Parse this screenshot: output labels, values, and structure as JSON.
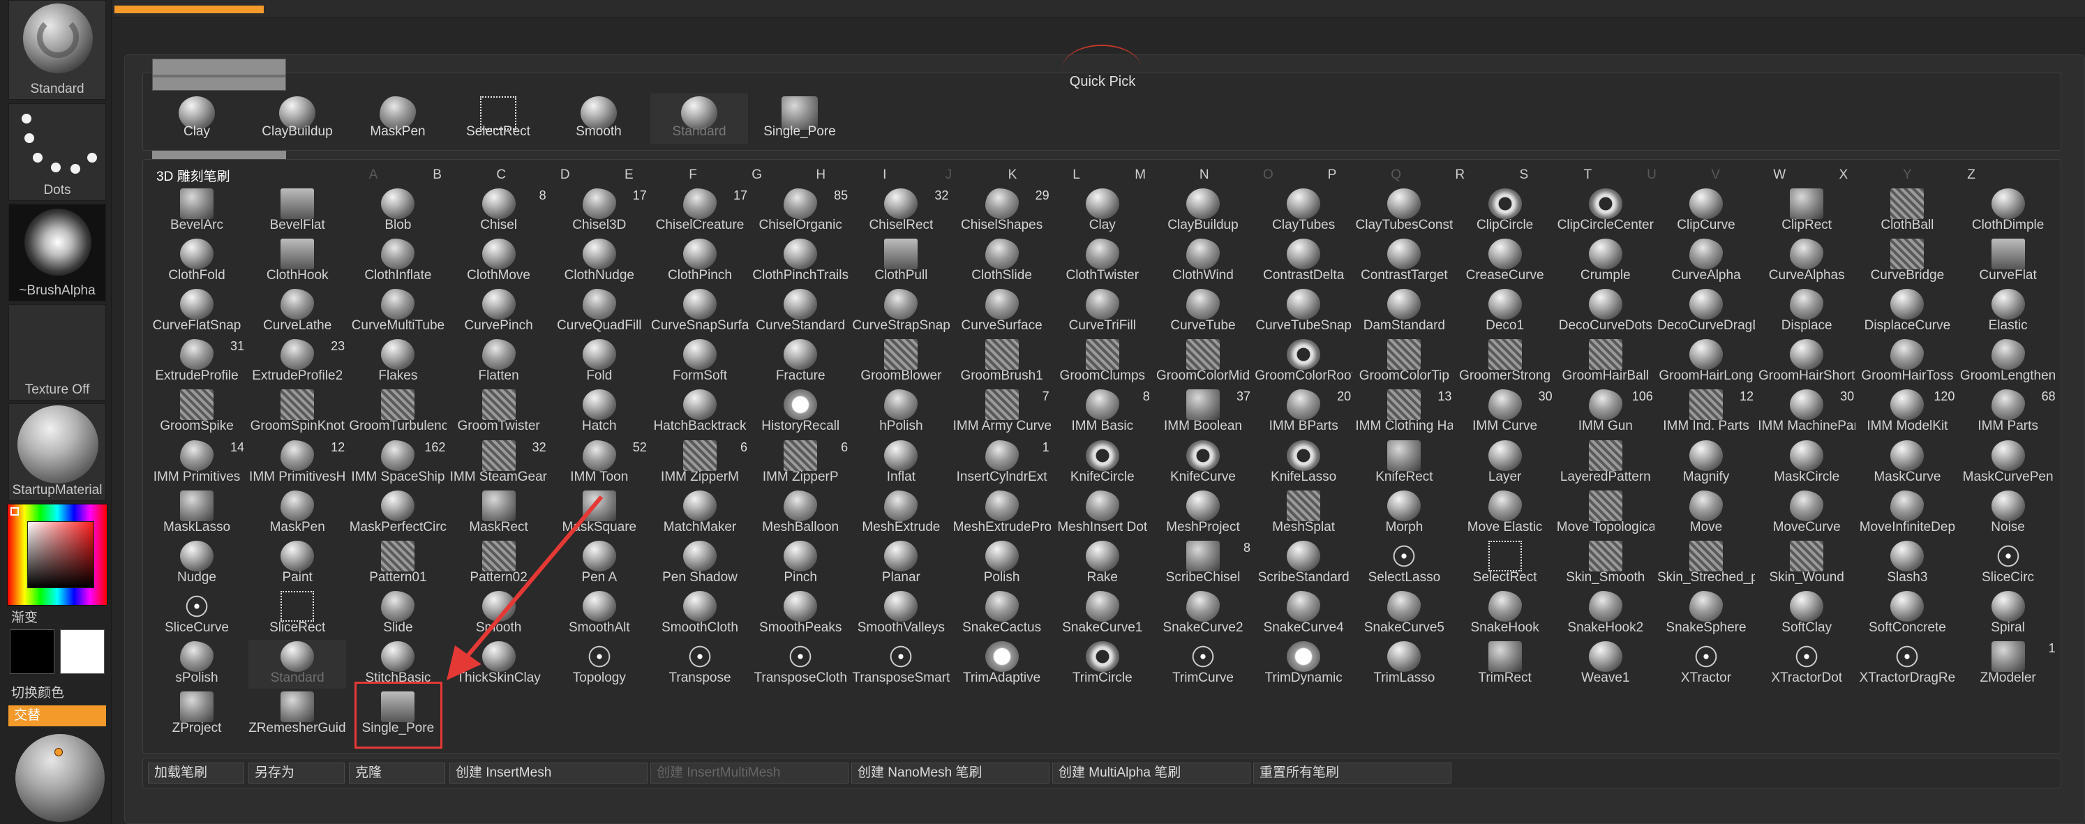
{
  "left_tray": {
    "brush_label": "Standard",
    "stroke_label": "Dots",
    "alpha_label": "~BrushAlpha",
    "texture_label": "Texture Off",
    "material_label": "StartupMaterial",
    "gradient_label": "渐变",
    "switch_color_label": "切换颜色",
    "alternate_label": "交替",
    "active_color": "#000000",
    "secondary_color": "#ffffff",
    "accent_color": "#f39a2b"
  },
  "quick_pick": {
    "title": "Quick Pick",
    "items": [
      {
        "label": "Clay",
        "icon": "sphere"
      },
      {
        "label": "ClayBuildup",
        "icon": "sphere"
      },
      {
        "label": "MaskPen",
        "icon": "mask"
      },
      {
        "label": "SelectRect",
        "icon": "select-rect"
      },
      {
        "label": "Smooth",
        "icon": "sphere"
      },
      {
        "label": "Standard",
        "icon": "sphere",
        "disabled": true
      },
      {
        "label": "Single_Pore",
        "icon": "square"
      }
    ]
  },
  "brushes": {
    "title": "3D 雕刻笔刷",
    "letters": [
      {
        "ch": "A",
        "dim": true
      },
      {
        "ch": "B"
      },
      {
        "ch": "C"
      },
      {
        "ch": "D"
      },
      {
        "ch": "E"
      },
      {
        "ch": "F"
      },
      {
        "ch": "G"
      },
      {
        "ch": "H"
      },
      {
        "ch": "I"
      },
      {
        "ch": "J",
        "dim": true
      },
      {
        "ch": "K"
      },
      {
        "ch": "L"
      },
      {
        "ch": "M"
      },
      {
        "ch": "N"
      },
      {
        "ch": "O",
        "dim": true
      },
      {
        "ch": "P"
      },
      {
        "ch": "Q",
        "dim": true
      },
      {
        "ch": "R"
      },
      {
        "ch": "S"
      },
      {
        "ch": "T"
      },
      {
        "ch": "U",
        "dim": true
      },
      {
        "ch": "V",
        "dim": true
      },
      {
        "ch": "W"
      },
      {
        "ch": "X"
      },
      {
        "ch": "Y",
        "dim": true
      },
      {
        "ch": "Z"
      }
    ],
    "rows": [
      [
        {
          "label": "BevelArc",
          "icon": "sq"
        },
        {
          "label": "BevelFlat",
          "icon": "flat"
        },
        {
          "label": "Blob",
          "icon": "sphere"
        },
        {
          "label": "Chisel",
          "icon": "sphere",
          "count": "8"
        },
        {
          "label": "Chisel3D",
          "icon": "blob",
          "count": "17"
        },
        {
          "label": "ChiselCreature",
          "icon": "blob",
          "count": "17"
        },
        {
          "label": "ChiselOrganic",
          "icon": "blob",
          "count": "85"
        },
        {
          "label": "ChiselRect",
          "icon": "sphere",
          "count": "32"
        },
        {
          "label": "ChiselShapes",
          "icon": "blob",
          "count": "29"
        },
        {
          "label": "Clay",
          "icon": "sphere"
        },
        {
          "label": "ClayBuildup",
          "icon": "sphere"
        },
        {
          "label": "ClayTubes",
          "icon": "sphere"
        },
        {
          "label": "ClayTubesConst",
          "icon": "sphere"
        },
        {
          "label": "ClipCircle",
          "icon": "ring"
        },
        {
          "label": "ClipCircleCenter",
          "icon": "ring"
        },
        {
          "label": "ClipCurve",
          "icon": "sphere"
        },
        {
          "label": "ClipRect",
          "icon": "sq"
        },
        {
          "label": "ClothBall",
          "icon": "tex"
        },
        {
          "label": "ClothDimple",
          "icon": "sphere"
        }
      ],
      [
        {
          "label": "ClothFold",
          "icon": "sphere"
        },
        {
          "label": "ClothHook",
          "icon": "flat"
        },
        {
          "label": "ClothInflate",
          "icon": "blob"
        },
        {
          "label": "ClothMove",
          "icon": "sphere"
        },
        {
          "label": "ClothNudge",
          "icon": "sphere"
        },
        {
          "label": "ClothPinch",
          "icon": "sphere"
        },
        {
          "label": "ClothPinchTrails",
          "icon": "sphere"
        },
        {
          "label": "ClothPull",
          "icon": "flat"
        },
        {
          "label": "ClothSlide",
          "icon": "blob"
        },
        {
          "label": "ClothTwister",
          "icon": "blob"
        },
        {
          "label": "ClothWind",
          "icon": "blob"
        },
        {
          "label": "ContrastDelta",
          "icon": "sphere"
        },
        {
          "label": "ContrastTarget",
          "icon": "sphere"
        },
        {
          "label": "CreaseCurve",
          "icon": "sphere"
        },
        {
          "label": "Crumple",
          "icon": "sphere"
        },
        {
          "label": "CurveAlpha",
          "icon": "blob"
        },
        {
          "label": "CurveAlphas",
          "icon": "blob"
        },
        {
          "label": "CurveBridge",
          "icon": "tex"
        },
        {
          "label": "CurveFlat",
          "icon": "flat"
        }
      ],
      [
        {
          "label": "CurveFlatSnap",
          "icon": "sphere"
        },
        {
          "label": "CurveLathe",
          "icon": "blob"
        },
        {
          "label": "CurveMultiTube",
          "icon": "blob"
        },
        {
          "label": "CurvePinch",
          "icon": "sphere"
        },
        {
          "label": "CurveQuadFill",
          "icon": "blob"
        },
        {
          "label": "CurveSnapSurface",
          "icon": "sphere"
        },
        {
          "label": "CurveStandard",
          "icon": "sphere"
        },
        {
          "label": "CurveStrapSnap",
          "icon": "blob"
        },
        {
          "label": "CurveSurface",
          "icon": "blob"
        },
        {
          "label": "CurveTriFill",
          "icon": "blob"
        },
        {
          "label": "CurveTube",
          "icon": "blob"
        },
        {
          "label": "CurveTubeSnap",
          "icon": "sphere"
        },
        {
          "label": "DamStandard",
          "icon": "sphere"
        },
        {
          "label": "Deco1",
          "icon": "sphere"
        },
        {
          "label": "DecoCurveDots",
          "icon": "sphere"
        },
        {
          "label": "DecoCurveDragD",
          "icon": "sphere"
        },
        {
          "label": "Displace",
          "icon": "blob"
        },
        {
          "label": "DisplaceCurve",
          "icon": "sphere"
        },
        {
          "label": "Elastic",
          "icon": "sphere"
        }
      ],
      [
        {
          "label": "ExtrudeProfile",
          "icon": "blob",
          "count": "31"
        },
        {
          "label": "ExtrudeProfile2",
          "icon": "blob",
          "count": "23"
        },
        {
          "label": "Flakes",
          "icon": "sphere"
        },
        {
          "label": "Flatten",
          "icon": "blob"
        },
        {
          "label": "Fold",
          "icon": "sphere"
        },
        {
          "label": "FormSoft",
          "icon": "sphere"
        },
        {
          "label": "Fracture",
          "icon": "sphere"
        },
        {
          "label": "GroomBlower",
          "icon": "tex"
        },
        {
          "label": "GroomBrush1",
          "icon": "tex"
        },
        {
          "label": "GroomClumps",
          "icon": "tex"
        },
        {
          "label": "GroomColorMid",
          "icon": "tex"
        },
        {
          "label": "GroomColorRoot",
          "icon": "ring"
        },
        {
          "label": "GroomColorTip",
          "icon": "tex"
        },
        {
          "label": "GroomerStrong",
          "icon": "tex"
        },
        {
          "label": "GroomHairBall",
          "icon": "tex"
        },
        {
          "label": "GroomHairLong",
          "icon": "sphere"
        },
        {
          "label": "GroomHairShort",
          "icon": "sphere"
        },
        {
          "label": "GroomHairToss",
          "icon": "blob"
        },
        {
          "label": "GroomLengthen",
          "icon": "blob"
        }
      ],
      [
        {
          "label": "GroomSpike",
          "icon": "tex"
        },
        {
          "label": "GroomSpinKnot",
          "icon": "tex"
        },
        {
          "label": "GroomTurbulence",
          "icon": "tex"
        },
        {
          "label": "GroomTwister",
          "icon": "tex"
        },
        {
          "label": "Hatch",
          "icon": "sphere"
        },
        {
          "label": "HatchBacktrack",
          "icon": "sphere"
        },
        {
          "label": "HistoryRecall",
          "icon": "icon-white"
        },
        {
          "label": "hPolish",
          "icon": "blob"
        },
        {
          "label": "IMM Army Curve",
          "icon": "tex",
          "count": "7"
        },
        {
          "label": "IMM Basic",
          "icon": "blob",
          "count": "8"
        },
        {
          "label": "IMM Boolean",
          "icon": "sq",
          "count": "37"
        },
        {
          "label": "IMM BParts",
          "icon": "blob",
          "count": "20"
        },
        {
          "label": "IMM Clothing Ha",
          "icon": "tex",
          "count": "13"
        },
        {
          "label": "IMM Curve",
          "icon": "blob",
          "count": "30"
        },
        {
          "label": "IMM Gun",
          "icon": "blob",
          "count": "106"
        },
        {
          "label": "IMM Ind. Parts",
          "icon": "tex",
          "count": "12"
        },
        {
          "label": "IMM MachinePar",
          "icon": "sphere",
          "count": "30"
        },
        {
          "label": "IMM ModelKit",
          "icon": "sphere",
          "count": "120"
        },
        {
          "label": "IMM Parts",
          "icon": "blob",
          "count": "68"
        }
      ],
      [
        {
          "label": "IMM Primitives",
          "icon": "blob",
          "count": "14"
        },
        {
          "label": "IMM PrimitivesH",
          "icon": "blob",
          "count": "12"
        },
        {
          "label": "IMM SpaceShip",
          "icon": "blob",
          "count": "162"
        },
        {
          "label": "IMM SteamGears",
          "icon": "tex",
          "count": "32"
        },
        {
          "label": "IMM Toon",
          "icon": "blob",
          "count": "52"
        },
        {
          "label": "IMM ZipperM",
          "icon": "tex",
          "count": "6"
        },
        {
          "label": "IMM ZipperP",
          "icon": "tex",
          "count": "6"
        },
        {
          "label": "Inflat",
          "icon": "sphere"
        },
        {
          "label": "InsertCylndrExt",
          "icon": "blob",
          "count": "1"
        },
        {
          "label": "KnifeCircle",
          "icon": "ring"
        },
        {
          "label": "KnifeCurve",
          "icon": "ring"
        },
        {
          "label": "KnifeLasso",
          "icon": "ring"
        },
        {
          "label": "KnifeRect",
          "icon": "sq"
        },
        {
          "label": "Layer",
          "icon": "sphere"
        },
        {
          "label": "LayeredPattern",
          "icon": "tex"
        },
        {
          "label": "Magnify",
          "icon": "sphere"
        },
        {
          "label": "MaskCircle",
          "icon": "sphere"
        },
        {
          "label": "MaskCurve",
          "icon": "sphere"
        },
        {
          "label": "MaskCurvePen",
          "icon": "sphere"
        }
      ],
      [
        {
          "label": "MaskLasso",
          "icon": "sq"
        },
        {
          "label": "MaskPen",
          "icon": "blob"
        },
        {
          "label": "MaskPerfectCirc",
          "icon": "sphere"
        },
        {
          "label": "MaskRect",
          "icon": "sq"
        },
        {
          "label": "MaskSquare",
          "icon": "sq"
        },
        {
          "label": "MatchMaker",
          "icon": "sphere"
        },
        {
          "label": "MeshBalloon",
          "icon": "blob"
        },
        {
          "label": "MeshExtrude",
          "icon": "blob"
        },
        {
          "label": "MeshExtrudePro",
          "icon": "blob"
        },
        {
          "label": "MeshInsert Dot",
          "icon": "blob"
        },
        {
          "label": "MeshProject",
          "icon": "sphere"
        },
        {
          "label": "MeshSplat",
          "icon": "tex"
        },
        {
          "label": "Morph",
          "icon": "sphere"
        },
        {
          "label": "Move Elastic",
          "icon": "blob"
        },
        {
          "label": "Move Topologica",
          "icon": "tex"
        },
        {
          "label": "Move",
          "icon": "blob"
        },
        {
          "label": "MoveCurve",
          "icon": "blob"
        },
        {
          "label": "MoveInfiniteDep",
          "icon": "blob"
        },
        {
          "label": "Noise",
          "icon": "sphere"
        }
      ],
      [
        {
          "label": "Nudge",
          "icon": "sphere"
        },
        {
          "label": "Paint",
          "icon": "sphere"
        },
        {
          "label": "Pattern01",
          "icon": "tex"
        },
        {
          "label": "Pattern02",
          "icon": "tex"
        },
        {
          "label": "Pen A",
          "icon": "sphere"
        },
        {
          "label": "Pen Shadow",
          "icon": "sphere"
        },
        {
          "label": "Pinch",
          "icon": "sphere"
        },
        {
          "label": "Planar",
          "icon": "sphere"
        },
        {
          "label": "Polish",
          "icon": "sphere"
        },
        {
          "label": "Rake",
          "icon": "sphere"
        },
        {
          "label": "ScribeChisel",
          "icon": "sq",
          "count": "8"
        },
        {
          "label": "ScribeStandard",
          "icon": "sphere"
        },
        {
          "label": "SelectLasso",
          "icon": "thin"
        },
        {
          "label": "SelectRect",
          "icon": "sel-box"
        },
        {
          "label": "Skin_Smooth",
          "icon": "tex"
        },
        {
          "label": "Skin_Streched_p",
          "icon": "tex"
        },
        {
          "label": "Skin_Wound",
          "icon": "tex"
        },
        {
          "label": "Slash3",
          "icon": "sphere"
        },
        {
          "label": "SliceCirc",
          "icon": "thin"
        }
      ],
      [
        {
          "label": "SliceCurve",
          "icon": "thin"
        },
        {
          "label": "SliceRect",
          "icon": "sel-box"
        },
        {
          "label": "Slide",
          "icon": "blob"
        },
        {
          "label": "Smooth",
          "icon": "sphere"
        },
        {
          "label": "SmoothAlt",
          "icon": "sphere"
        },
        {
          "label": "SmoothCloth",
          "icon": "sphere"
        },
        {
          "label": "SmoothPeaks",
          "icon": "sphere"
        },
        {
          "label": "SmoothValleys",
          "icon": "sphere"
        },
        {
          "label": "SnakeCactus",
          "icon": "blob"
        },
        {
          "label": "SnakeCurve1",
          "icon": "blob"
        },
        {
          "label": "SnakeCurve2",
          "icon": "blob"
        },
        {
          "label": "SnakeCurve4",
          "icon": "blob"
        },
        {
          "label": "SnakeCurve5",
          "icon": "blob"
        },
        {
          "label": "SnakeHook",
          "icon": "blob"
        },
        {
          "label": "SnakeHook2",
          "icon": "blob"
        },
        {
          "label": "SnakeSphere",
          "icon": "blob"
        },
        {
          "label": "SoftClay",
          "icon": "sphere"
        },
        {
          "label": "SoftConcrete",
          "icon": "sphere"
        },
        {
          "label": "Spiral",
          "icon": "sphere"
        }
      ],
      [
        {
          "label": "sPolish",
          "icon": "blob"
        },
        {
          "label": "Standard",
          "icon": "sphere",
          "disabled": true
        },
        {
          "label": "StitchBasic",
          "icon": "sphere"
        },
        {
          "label": "ThickSkinClay",
          "icon": "sphere"
        },
        {
          "label": "Topology",
          "icon": "thin"
        },
        {
          "label": "Transpose",
          "icon": "thin"
        },
        {
          "label": "TransposeCloth",
          "icon": "thin"
        },
        {
          "label": "TransposeSmart",
          "icon": "thin"
        },
        {
          "label": "TrimAdaptive",
          "icon": "icon-white"
        },
        {
          "label": "TrimCircle",
          "icon": "ring"
        },
        {
          "label": "TrimCurve",
          "icon": "thin"
        },
        {
          "label": "TrimDynamic",
          "icon": "icon-white"
        },
        {
          "label": "TrimLasso",
          "icon": "sphere"
        },
        {
          "label": "TrimRect",
          "icon": "sq"
        },
        {
          "label": "Weave1",
          "icon": "sphere"
        },
        {
          "label": "XTractor",
          "icon": "thin"
        },
        {
          "label": "XTractorDot",
          "icon": "thin"
        },
        {
          "label": "XTractorDragRe",
          "icon": "thin"
        },
        {
          "label": "ZModeler",
          "icon": "sq",
          "count": "1"
        }
      ],
      [
        {
          "label": "ZProject",
          "icon": "sq"
        },
        {
          "label": "ZRemesherGuide",
          "icon": "sq"
        },
        {
          "label": "Single_Pore",
          "icon": "flat"
        }
      ]
    ]
  },
  "commands": [
    {
      "label": "加载笔刷"
    },
    {
      "label": "另存为"
    },
    {
      "label": "克隆"
    },
    {
      "label": "创建 InsertMesh"
    },
    {
      "label": "创建 InsertMultiMesh",
      "disabled": true
    },
    {
      "label": "创建 NanoMesh 笔刷"
    },
    {
      "label": "创建 MultiAlpha 笔刷"
    },
    {
      "label": "重置所有笔刷"
    }
  ],
  "annotation": {
    "arrow_color": "#e53935"
  }
}
